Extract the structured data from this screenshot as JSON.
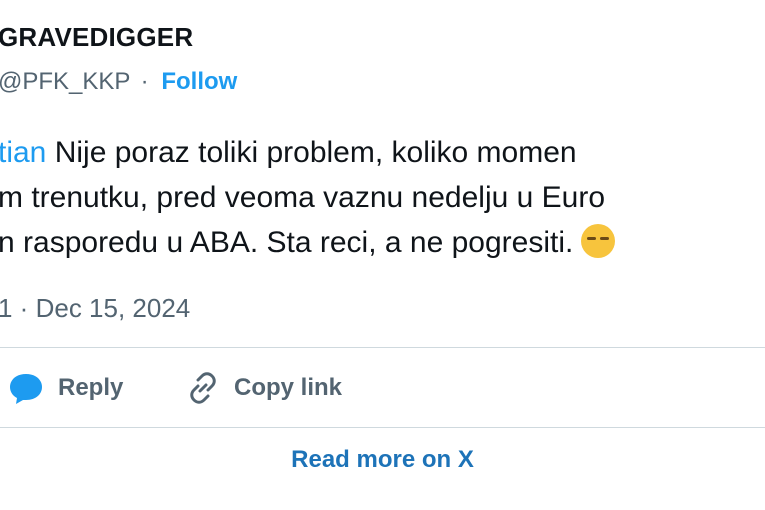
{
  "tweet": {
    "display_name": "GRAVEDIGGER",
    "handle": "@PFK_KKP",
    "separator": "·",
    "follow_label": "Follow",
    "mention": "tian",
    "line1_text": " Nije poraz toliki problem, koliko momen",
    "line2_text": "m trenutku, pred veoma vaznu nedelju u Euro",
    "line3_text": "n rasporedu u ABA. Sta reci, a ne pogresiti.",
    "emoji_icon": "face-with-tears-emoji-icon",
    "timestamp_prefix": "1 · ",
    "timestamp": "Dec 15, 2024"
  },
  "actions": {
    "reply_label": "Reply",
    "copy_link_label": "Copy link"
  },
  "footer": {
    "read_more_label": "Read more on X"
  },
  "colors": {
    "accent": "#1d9bf0",
    "secondary_text": "#536471",
    "primary_text": "#0f1419",
    "read_more": "#1d73b8"
  }
}
